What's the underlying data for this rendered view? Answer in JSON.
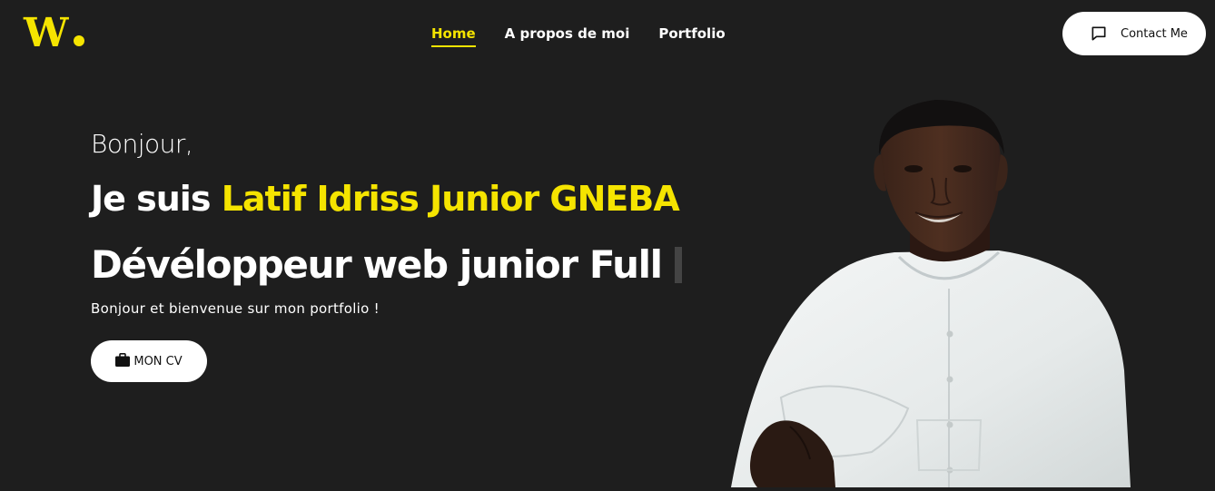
{
  "logo": {
    "letter": "W"
  },
  "nav": {
    "items": [
      {
        "label": "Home",
        "active": true
      },
      {
        "label": "A propos de moi",
        "active": false
      },
      {
        "label": "Portfolio",
        "active": false
      }
    ]
  },
  "contact": {
    "label": "Contact Me",
    "icon": "message-square-icon"
  },
  "hero": {
    "greeting": "Bonjour,",
    "intro_prefix": "Je suis ",
    "name": "Latif Idriss Junior GNEBA",
    "role": "Dévéloppeur web junior Full",
    "welcome": "Bonjour et bienvenue sur mon portfolio !",
    "cv_button": {
      "label": "MON CV",
      "icon": "briefcase-icon"
    }
  },
  "colors": {
    "background": "#1e1e1e",
    "accent": "#f5e400",
    "text": "#ffffff",
    "button_bg": "#ffffff",
    "button_text": "#111111"
  }
}
